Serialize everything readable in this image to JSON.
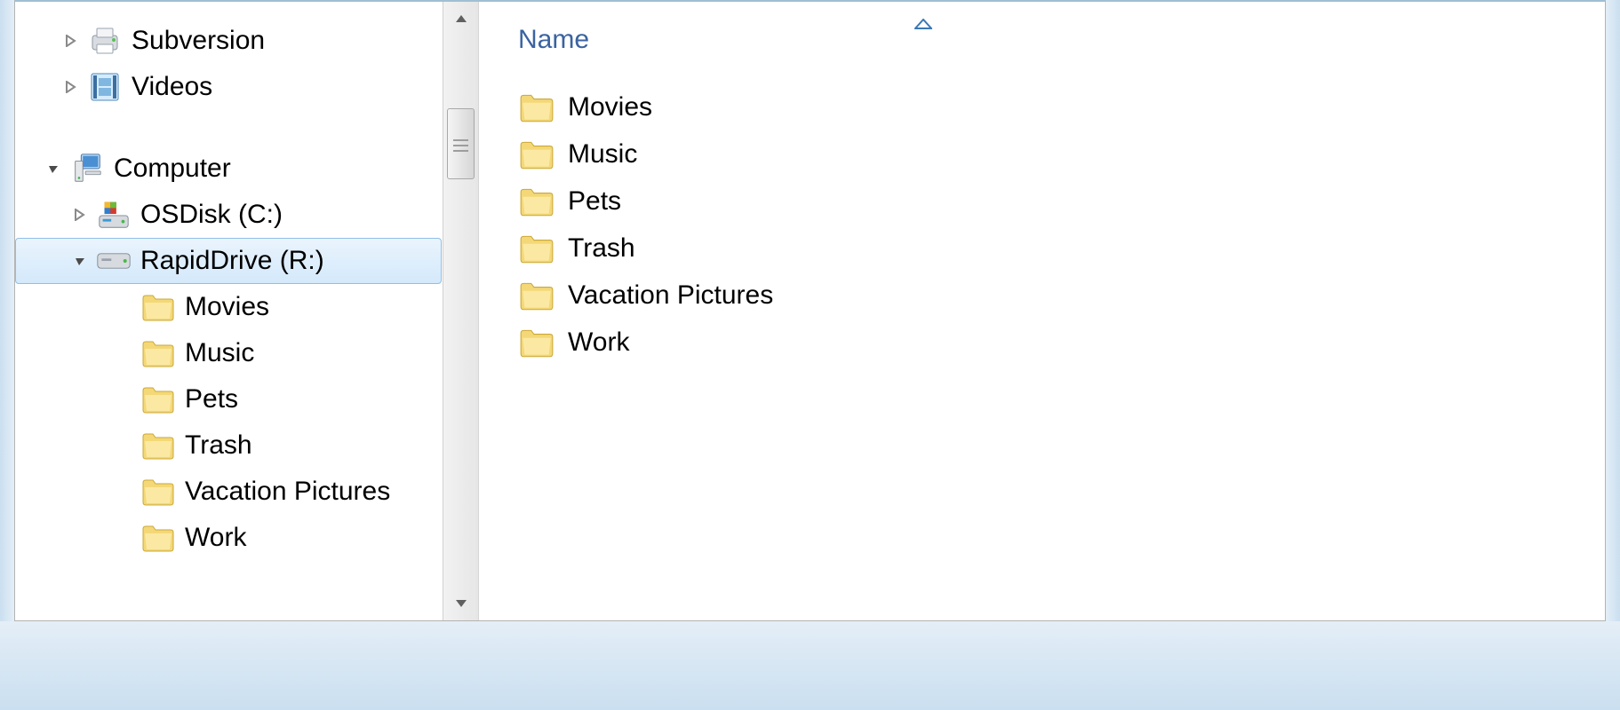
{
  "tree": {
    "nodes": [
      {
        "label": "Subversion",
        "icon": "printer",
        "expander": "closed",
        "indent": "indent-1",
        "selected": false
      },
      {
        "label": "Videos",
        "icon": "film",
        "expander": "closed",
        "indent": "indent-1",
        "selected": false
      }
    ],
    "computer": {
      "label": "Computer",
      "children": [
        {
          "label": "OSDisk (C:)",
          "icon": "osdisk",
          "expander": "closed",
          "indent": "indent-2",
          "selected": false
        },
        {
          "label": "RapidDrive (R:)",
          "icon": "drive",
          "expander": "open",
          "indent": "indent-2",
          "selected": true,
          "children": [
            {
              "label": "Movies"
            },
            {
              "label": "Music"
            },
            {
              "label": "Pets"
            },
            {
              "label": "Trash"
            },
            {
              "label": "Vacation Pictures"
            },
            {
              "label": "Work"
            }
          ]
        }
      ]
    }
  },
  "list": {
    "column": "Name",
    "items": [
      {
        "label": "Movies"
      },
      {
        "label": "Music"
      },
      {
        "label": "Pets"
      },
      {
        "label": "Trash"
      },
      {
        "label": "Vacation Pictures"
      },
      {
        "label": "Work"
      }
    ]
  }
}
